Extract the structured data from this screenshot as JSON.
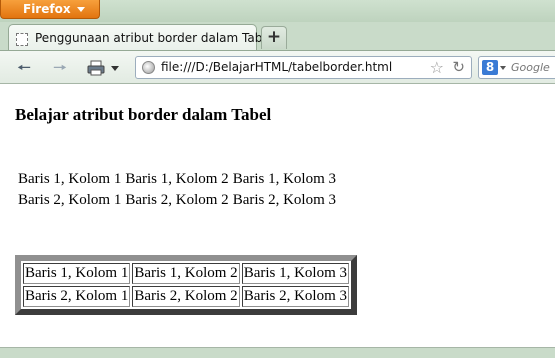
{
  "browser": {
    "menu_button_label": "Firefox",
    "tab_title": "Penggunaan atribut border dalam Tabel",
    "new_tab_symbol": "+",
    "url": "file:///D:/BelajarHTML/tabelborder.html",
    "search_placeholder": "Google",
    "search_engine_letter": "8"
  },
  "page": {
    "heading": "Belajar atribut border dalam Tabel",
    "table_no_border": [
      [
        "Baris 1, Kolom 1",
        "Baris 1, Kolom 2",
        "Baris 1, Kolom 3"
      ],
      [
        "Baris 2, Kolom 1",
        "Baris 2, Kolom 2",
        "Baris 2, Kolom 3"
      ]
    ],
    "table_bordered": [
      [
        "Baris 1, Kolom 1",
        "Baris 1, Kolom 2",
        "Baris 1, Kolom 3"
      ],
      [
        "Baris 2, Kolom 1",
        "Baris 2, Kolom 2",
        "Baris 2, Kolom 3"
      ]
    ]
  },
  "icons": [
    "back-icon",
    "forward-icon",
    "print-icon",
    "dropdown-icon",
    "globe-icon",
    "bookmark-star-icon",
    "reload-icon",
    "google-icon"
  ]
}
